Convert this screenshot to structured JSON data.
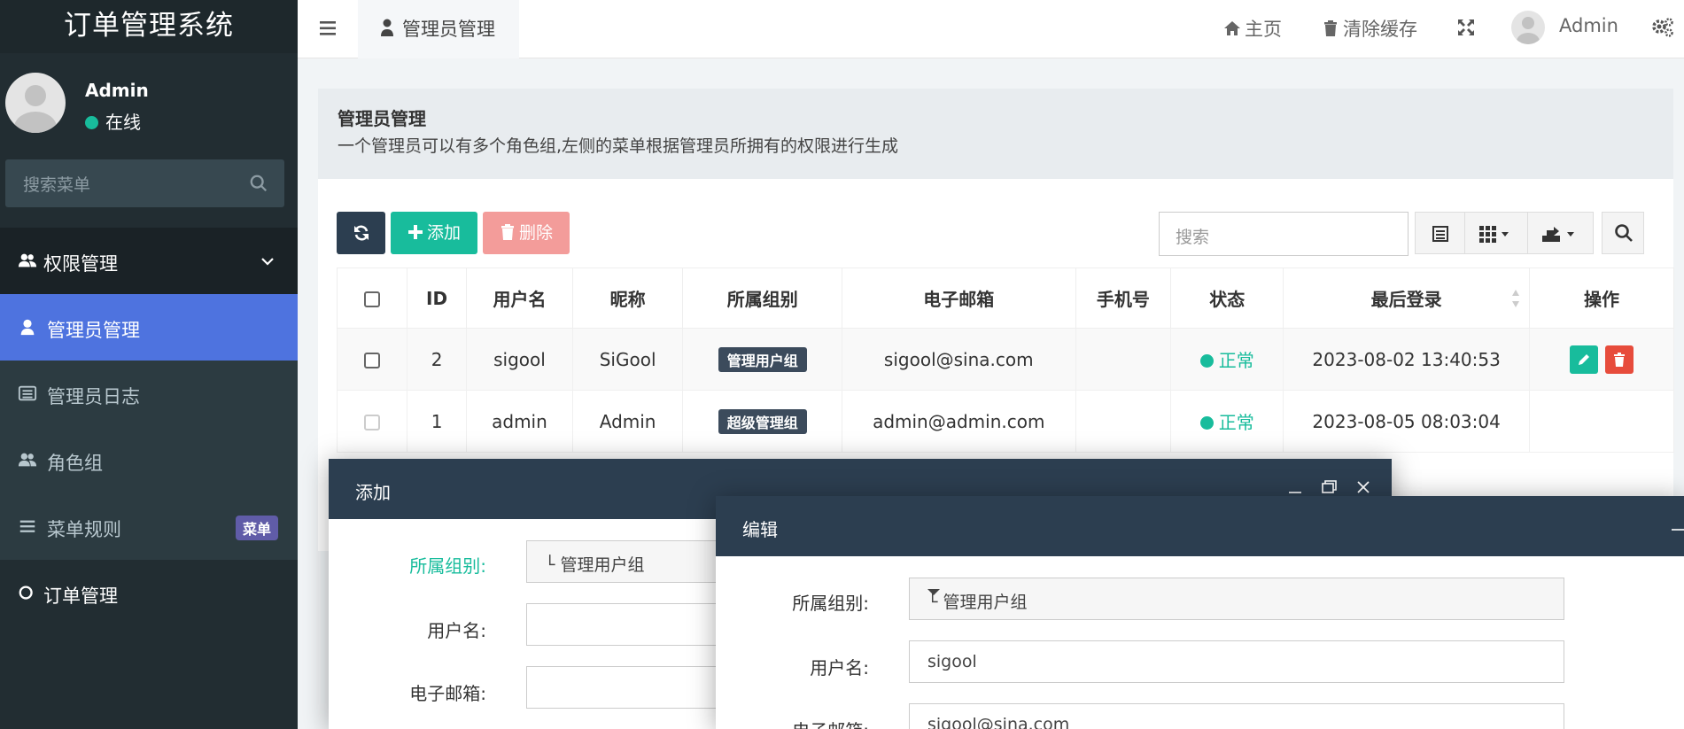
{
  "sidebar": {
    "title": "订单管理系统",
    "user": {
      "name": "Admin",
      "status": "在线"
    },
    "search": {
      "placeholder": "搜索菜单"
    },
    "menu": {
      "auth": "权限管理",
      "admin": "管理员管理",
      "log": "管理员日志",
      "group": "角色组",
      "rule": "菜单规则",
      "rule_badge": "菜单",
      "order": "订单管理"
    }
  },
  "navbar": {
    "tab": "管理员管理",
    "home": "主页",
    "clear_cache": "清除缓存",
    "user": "Admin"
  },
  "page": {
    "title": "管理员管理",
    "description": "一个管理员可以有多个角色组,左侧的菜单根据管理员所拥有的权限进行生成"
  },
  "toolbar": {
    "add": "添加",
    "delete": "删除",
    "search_placeholder": "搜索"
  },
  "table": {
    "headers": [
      "ID",
      "用户名",
      "昵称",
      "所属组别",
      "电子邮箱",
      "手机号",
      "状态",
      "最后登录",
      "操作"
    ],
    "rows": [
      {
        "id": "2",
        "username": "sigool",
        "nickname": "SiGool",
        "group": "管理用户组",
        "email": "sigool@sina.com",
        "mobile": "",
        "status": "正常",
        "last_login": "2023-08-02 13:40:53"
      },
      {
        "id": "1",
        "username": "admin",
        "nickname": "Admin",
        "group": "超级管理组",
        "email": "admin@admin.com",
        "mobile": "",
        "status": "正常",
        "last_login": "2023-08-05 08:03:04"
      }
    ]
  },
  "dialog_add": {
    "title": "添加",
    "labels": {
      "group": "所属组别:",
      "username": "用户名:",
      "email": "电子邮箱:"
    },
    "group_value": "└ 管理用户组"
  },
  "dialog_edit": {
    "title": "编辑",
    "labels": {
      "group": "所属组别:",
      "username": "用户名:",
      "email": "电子邮箱:"
    },
    "group_value": "└ 管理用户组",
    "username_value": "sigool",
    "email_value": "sigool@sina.com"
  },
  "colors": {
    "sidebar_bg": "#222d32",
    "active_menu": "#4e73df",
    "success": "#18bc9c",
    "danger": "#e74c3c",
    "dialog_header": "#2c3e50"
  }
}
